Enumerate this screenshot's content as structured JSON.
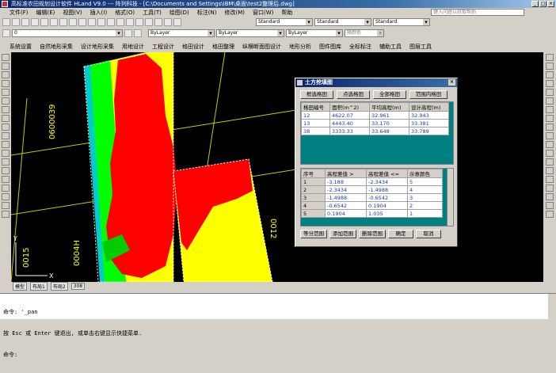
{
  "window": {
    "title": "高标准农田规划设计软件 HLand V9.0 --- 阵列科技 - [C:\\Documents and Settings\\IBM\\桌面\\test2整理后.dwg]",
    "min": "_",
    "max": "□",
    "close": "×"
  },
  "menu": {
    "items": [
      "文件(F)",
      "编辑(E)",
      "视图(V)",
      "插入(I)",
      "格式(O)",
      "工具(T)",
      "绘图(D)",
      "标注(N)",
      "修改(M)",
      "窗口(W)",
      "帮助"
    ],
    "help_placeholder": "键入问题以获取帮助"
  },
  "toolbar": {
    "text_style": "Standard",
    "dim_style": "Standard",
    "table_style": "Standard",
    "layer": "0",
    "color": "ByLayer",
    "linetype": "ByLayer",
    "lineweight": "ByLayer",
    "plotstyle": "随颜色"
  },
  "tabs": [
    "系统设置",
    "自然地形采集",
    "设计地形采集",
    "用地设计",
    "工程设计",
    "格田设计",
    "格田整理",
    "纵横断面图设计",
    "地形分析",
    "图件图库",
    "全标标注",
    "辅助工具",
    "图层工具"
  ],
  "canvas": {
    "labels": [
      "0600039",
      "0004H",
      "0015",
      "0012"
    ],
    "axis": {
      "x": "X",
      "y": "Y"
    }
  },
  "statusbar": {
    "tabs": [
      "模型",
      "布局1",
      "布局2"
    ],
    "value": "308"
  },
  "dialog": {
    "title": "土方挖填图",
    "top_buttons": [
      "框选格田",
      "点选格田",
      "全部格田",
      "范围内格田"
    ],
    "table1": {
      "headers": [
        "格田编号",
        "面积(m^2)",
        "平均高程(m)",
        "设计高程(m)"
      ],
      "rows": [
        [
          "12",
          "4622.07",
          "32.961",
          "32.943"
        ],
        [
          "13",
          "4443.40",
          "33.170",
          "33.381"
        ],
        [
          "38",
          "3333.33",
          "33.648",
          "33.789"
        ]
      ]
    },
    "table2": {
      "headers": [
        "序号",
        "高程差值 >",
        "高程差值 <=",
        "示意颜色"
      ],
      "rows": [
        [
          "1",
          "-3.188",
          "-2.3434",
          "5"
        ],
        [
          "2",
          "-2.3434",
          "-1.4988",
          "4"
        ],
        [
          "3",
          "-1.4988",
          "-0.6542",
          "3"
        ],
        [
          "4",
          "-0.6542",
          "0.1904",
          "2"
        ],
        [
          "5",
          "0.1904",
          "1.035",
          "1"
        ]
      ]
    },
    "bottom_buttons": [
      "等分范围",
      "添加范围",
      "删除范围",
      "确定",
      "取消"
    ]
  },
  "command": {
    "lines": [
      "命令: '_pan",
      "按 Esc 或 Enter 键退出, 或单击右键显示快捷菜单.",
      "命令:"
    ]
  },
  "colors": {
    "red": "#ff0000",
    "yellow": "#ffff00",
    "green": "#00ff00",
    "cyan": "#00cccc",
    "titlebar": "#0a246a"
  }
}
